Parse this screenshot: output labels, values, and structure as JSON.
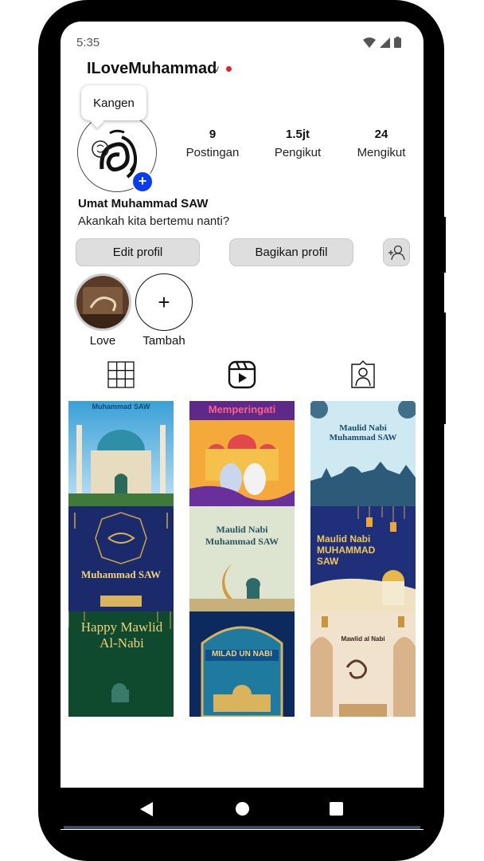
{
  "status": {
    "time": "5:35"
  },
  "header": {
    "username": "ILoveMuhammad",
    "chevron": "v"
  },
  "note": {
    "text": "Kangen"
  },
  "stats": [
    {
      "number": "9",
      "label": "Postingan"
    },
    {
      "number": "1.5jt",
      "label": "Pengikut"
    },
    {
      "number": "24",
      "label": "Mengikut"
    }
  ],
  "profile": {
    "name": "Umat Muhammad SAW",
    "bio": "Akankah kita bertemu nanti?"
  },
  "buttons": {
    "edit": "Edit profil",
    "share": "Bagikan profil"
  },
  "highlights": [
    {
      "label": "Love"
    },
    {
      "label": "Tambah",
      "icon": "+"
    }
  ],
  "posts": [
    {
      "text": "Muhammad SAW"
    },
    {
      "text": "Memperingati"
    },
    {
      "text": "Maulid Nabi Muhammad SAW"
    },
    {
      "text": "Muhammad SAW"
    },
    {
      "text": "Maulid Nabi Muhammad SAW"
    },
    {
      "text": "Maulid Nabi MUHAMMAD SAW"
    },
    {
      "text": "Happy Mawlid Al-Nabi"
    },
    {
      "text": "MILAD UN NABI"
    },
    {
      "text": "Mawlid al Nabi"
    }
  ],
  "colors": {
    "accent_blue": "#0a3df0",
    "red_dot": "#e0242e"
  }
}
